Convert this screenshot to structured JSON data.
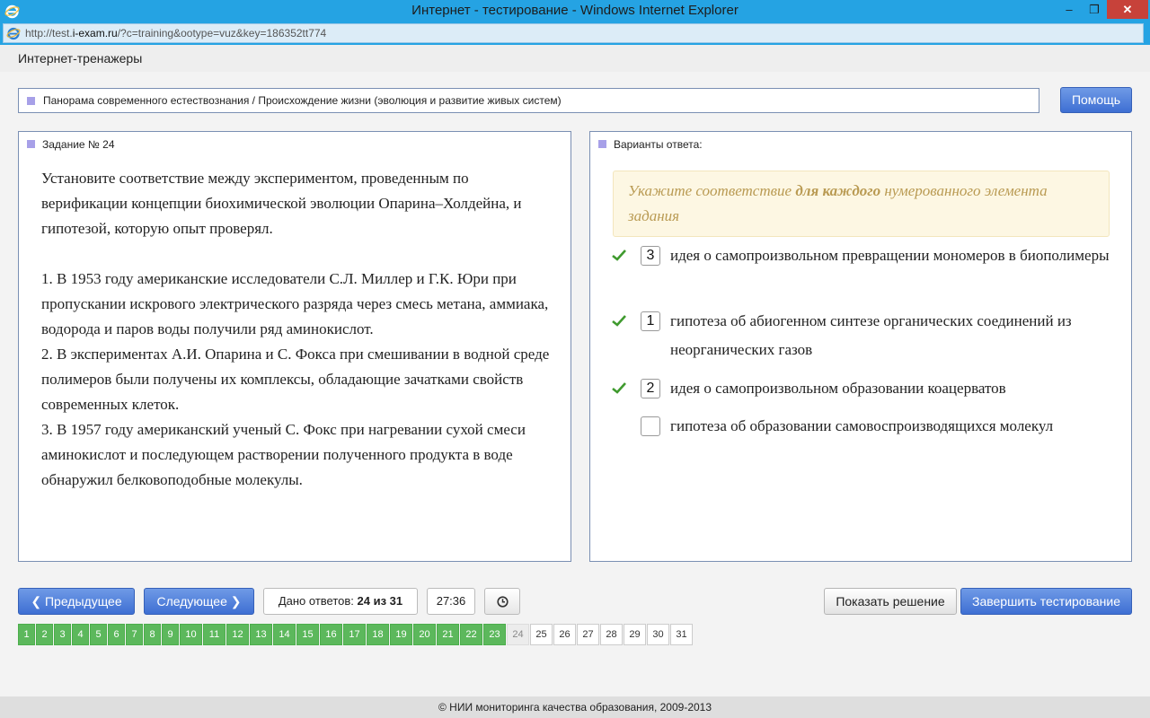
{
  "window": {
    "title": "Интернет - тестирование - Windows Internet Explorer",
    "minimize": "–",
    "maximize": "❐",
    "close": "✕",
    "url_prefix": "http://test.",
    "url_domain": "i-exam.ru",
    "url_rest": "/?c=training&ootype=vuz&key=186352tt774"
  },
  "header": {
    "site_name": "Интернет-тренажеры"
  },
  "topic": {
    "path": "Панорама современного естествознания / Происхождение жизни (эволюция и развитие живых систем)",
    "help_label": "Помощь"
  },
  "task": {
    "title": "Задание № 24",
    "intro": "Установите соответствие между экспериментом, проведенным по верификации концепции биохимической эволюции Опарина–Холдейна, и гипотезой, которую опыт проверял.",
    "items": [
      "1. В 1953 году американские исследователи С.Л. Миллер и Г.К. Юри при пропускании искрового электрического разряда через смесь метана, аммиака, водорода и паров воды получили ряд аминокислот.",
      "2. В экспериментах А.И. Опарина и С. Фокса при смешивании в водной среде полимеров были получены их комплексы, обладающие зачатками свойств современных клеток.",
      "3. В 1957 году американский ученый С. Фокс при нагревании сухой смеси аминокислот и последующем растворении полученного продукта в воде обнаружил белковоподобные молекулы."
    ]
  },
  "answers": {
    "title": "Варианты ответа:",
    "hint_pre": "Укажите соответствие ",
    "hint_bold": "для каждого",
    "hint_post": " нумерованного элемента задания",
    "options": [
      {
        "value": "3",
        "text": "идея о самопроизвольном превращении мономеров в биополимеры",
        "checked": true
      },
      {
        "value": "1",
        "text": "гипотеза об абиогенном синтезе органических соединений из неорганических газов",
        "checked": true
      },
      {
        "value": "2",
        "text": "идея о самопроизвольном образовании коацерватов",
        "checked": true
      },
      {
        "value": "",
        "text": "гипотеза об образовании самовоспроизводящихся молекул",
        "checked": false
      }
    ]
  },
  "controls": {
    "prev_label": "Предыдущее",
    "next_label": "Следующее",
    "answered_label": "Дано ответов:",
    "answered_value": "24 из 31",
    "timer": "27:36",
    "show_solution_label": "Показать решение",
    "finish_label": "Завершить тестирование"
  },
  "pagination": {
    "pages": [
      "1",
      "2",
      "3",
      "4",
      "5",
      "6",
      "7",
      "8",
      "9",
      "10",
      "11",
      "12",
      "13",
      "14",
      "15",
      "16",
      "17",
      "18",
      "19",
      "20",
      "21",
      "22",
      "23",
      "24",
      "25",
      "26",
      "27",
      "28",
      "29",
      "30",
      "31"
    ],
    "answered_up_to": 23,
    "current": 24
  },
  "footer": {
    "text": "© НИИ мониторинга качества образования, 2009-2013"
  },
  "colors": {
    "accent": "#3e6fd3",
    "done": "#5cb85c",
    "titlebar": "#25a3e3"
  }
}
